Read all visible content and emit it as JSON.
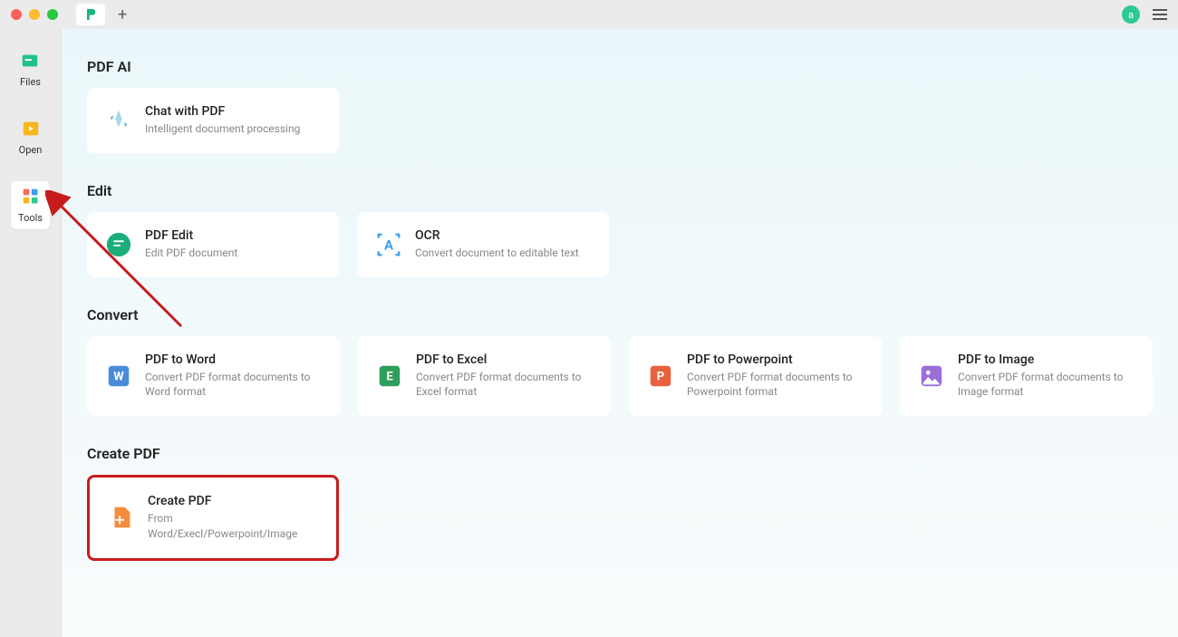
{
  "avatar": "a",
  "sidebar": {
    "items": [
      {
        "label": "Files"
      },
      {
        "label": "Open"
      },
      {
        "label": "Tools"
      }
    ]
  },
  "sections": {
    "pdfai": {
      "title": "PDF AI",
      "cards": [
        {
          "title": "Chat with PDF",
          "sub": "Intelligent document processing"
        }
      ]
    },
    "edit": {
      "title": "Edit",
      "cards": [
        {
          "title": "PDF Edit",
          "sub": "Edit PDF document"
        },
        {
          "title": "OCR",
          "sub": "Convert document to editable text"
        }
      ]
    },
    "convert": {
      "title": "Convert",
      "cards": [
        {
          "title": "PDF to Word",
          "sub": "Convert PDF format documents to Word format"
        },
        {
          "title": "PDF to Excel",
          "sub": "Convert PDF format documents to Excel format"
        },
        {
          "title": "PDF to Powerpoint",
          "sub": "Convert PDF format documents to Powerpoint format"
        },
        {
          "title": "PDF to Image",
          "sub": "Convert PDF format documents to Image format"
        }
      ]
    },
    "createpdf": {
      "title": "Create PDF",
      "cards": [
        {
          "title": "Create PDF",
          "sub": "From Word/Execl/Powerpoint/Image"
        }
      ]
    }
  }
}
